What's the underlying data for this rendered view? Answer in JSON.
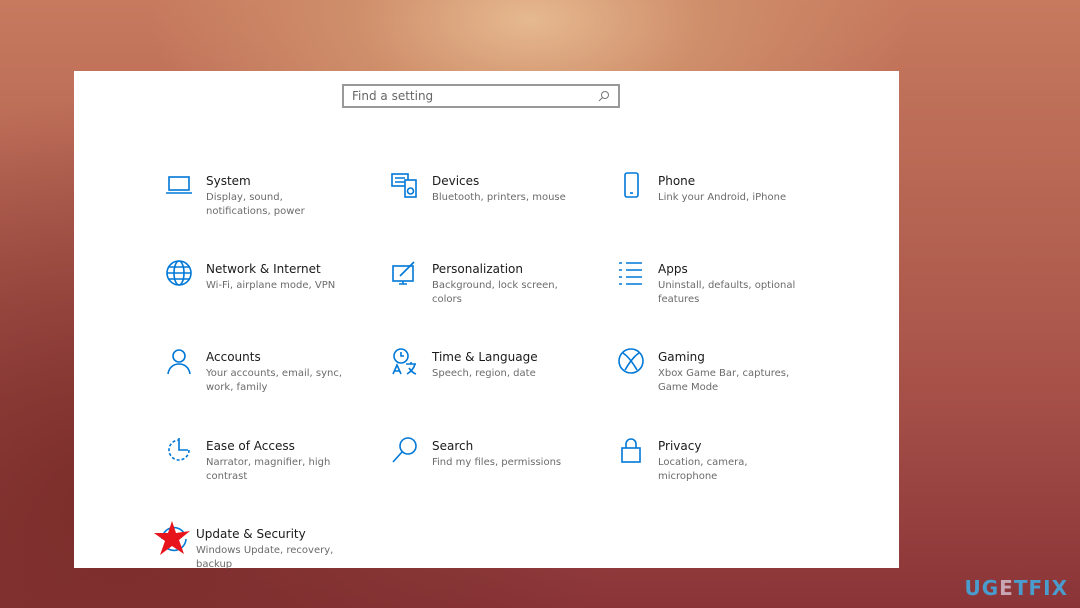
{
  "search": {
    "placeholder": "Find a setting",
    "icon": "search-icon"
  },
  "accent": "#0078d7",
  "items": [
    {
      "title": "System",
      "desc": "Display, sound, notifications, power",
      "icon": "laptop-icon"
    },
    {
      "title": "Devices",
      "desc": "Bluetooth, printers, mouse",
      "icon": "devices-icon"
    },
    {
      "title": "Phone",
      "desc": "Link your Android, iPhone",
      "icon": "phone-icon"
    },
    {
      "title": "Network & Internet",
      "desc": "Wi-Fi, airplane mode, VPN",
      "icon": "globe-icon"
    },
    {
      "title": "Personalization",
      "desc": "Background, lock screen, colors",
      "icon": "paint-icon"
    },
    {
      "title": "Apps",
      "desc": "Uninstall, defaults, optional features",
      "icon": "apps-list-icon"
    },
    {
      "title": "Accounts",
      "desc": "Your accounts, email, sync, work, family",
      "icon": "person-icon"
    },
    {
      "title": "Time & Language",
      "desc": "Speech, region, date",
      "icon": "time-language-icon"
    },
    {
      "title": "Gaming",
      "desc": "Xbox Game Bar, captures, Game Mode",
      "icon": "xbox-icon"
    },
    {
      "title": "Ease of Access",
      "desc": "Narrator, magnifier, high contrast",
      "icon": "ease-of-access-icon"
    },
    {
      "title": "Search",
      "desc": "Find my files, permissions",
      "icon": "magnifier-icon"
    },
    {
      "title": "Privacy",
      "desc": "Location, camera, microphone",
      "icon": "lock-icon"
    },
    {
      "title": "Update & Security",
      "desc": "Windows Update, recovery, backup",
      "icon": "update-icon"
    }
  ],
  "watermark": {
    "left": "UG",
    "mid": "E",
    "right": "TFIX"
  }
}
